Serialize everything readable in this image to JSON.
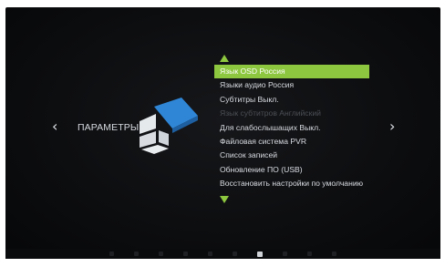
{
  "nav": {
    "left_arrow": "‹",
    "right_arrow": "›"
  },
  "section": {
    "title": "ПАРАМЕТРЫ",
    "icon": "settings-cube-icon"
  },
  "menu": {
    "items": [
      {
        "label": "Язык OSD Россия",
        "state": "selected"
      },
      {
        "label": "Языки аудио Россия",
        "state": "normal"
      },
      {
        "label": "Субтитры Выкл.",
        "state": "normal"
      },
      {
        "label": "Язык субтитров Английский",
        "state": "disabled"
      },
      {
        "label": "Для слабослышащих Выкл.",
        "state": "normal"
      },
      {
        "label": "Файловая система PVR",
        "state": "normal"
      },
      {
        "label": "Список записей",
        "state": "normal"
      },
      {
        "label": "Обновление ПО (USB)",
        "state": "normal"
      },
      {
        "label": "Восстановить настройки по умолчанию",
        "state": "normal"
      }
    ]
  },
  "colors": {
    "accent": "#8dc63f",
    "background": "#0e0f11",
    "logo_blue": "#2f86d6",
    "logo_white": "#e6e9ec"
  }
}
